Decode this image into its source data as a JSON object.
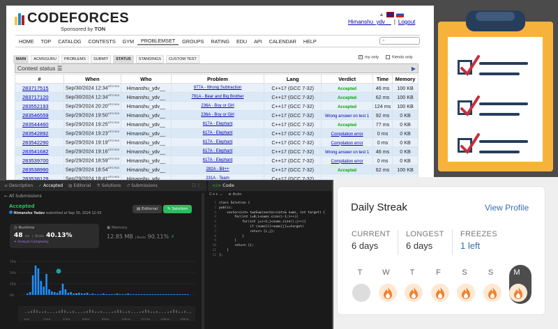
{
  "codeforces": {
    "brand": "CODEFORCES",
    "sponsor_prefix": "Sponsored by",
    "sponsor": "TON",
    "user": "Himanshu_ydv__",
    "logout": "Logout",
    "menu": [
      "HOME",
      "TOP",
      "CATALOG",
      "CONTESTS",
      "GYM",
      "PROBLEMSET",
      "GROUPS",
      "RATING",
      "EDU",
      "API",
      "CALENDAR",
      "HELP"
    ],
    "subtabs": [
      "MAIN",
      "ACMSGURU",
      "PROBLEMS",
      "SUBMIT",
      "STATUS",
      "STANDINGS",
      "CUSTOM TEST"
    ],
    "my_only": "my only",
    "friends_only": "friends only",
    "status_title": "Contest status",
    "columns": [
      "#",
      "When",
      "Who",
      "Problem",
      "Lang",
      "Verdict",
      "Time",
      "Memory"
    ],
    "rows": [
      {
        "id": "283717515",
        "when": "Sep/30/2024 12:34",
        "who": "Himanshu_ydv__",
        "problem": "977A - Wrong Subtraction",
        "lang": "C++17 (GCC 7-32)",
        "verdict": "Accepted",
        "vclass": "acc",
        "time": "46 ms",
        "mem": "100 KB"
      },
      {
        "id": "283717120",
        "when": "Sep/30/2024 12:34",
        "who": "Himanshu_ydv__",
        "problem": "791A - Bear and Big Brother",
        "lang": "C++17 (GCC 7-32)",
        "verdict": "Accepted",
        "vclass": "acc",
        "time": "62 ms",
        "mem": "100 KB"
      },
      {
        "id": "283552193",
        "when": "Sep/29/2024 20:20",
        "who": "Himanshu_ydv__",
        "problem": "236A - Boy or Girl",
        "lang": "C++17 (GCC 7-32)",
        "verdict": "Accepted",
        "vclass": "acc",
        "time": "124 ms",
        "mem": "100 KB"
      },
      {
        "id": "283546559",
        "when": "Sep/29/2024 19:50",
        "who": "Himanshu_ydv__",
        "problem": "236A - Boy or Girl",
        "lang": "C++17 (GCC 7-32)",
        "verdict": "Wrong answer on test 1",
        "vclass": "wa",
        "time": "92 ms",
        "mem": "0 KB"
      },
      {
        "id": "283544460",
        "when": "Sep/29/2024 19:25",
        "who": "Himanshu_ydv__",
        "problem": "617A - Elephant",
        "lang": "C++17 (GCC 7-32)",
        "verdict": "Accepted",
        "vclass": "acc",
        "time": "77 ms",
        "mem": "0 KB"
      },
      {
        "id": "283542892",
        "when": "Sep/29/2024 19:23",
        "who": "Himanshu_ydv__",
        "problem": "617A - Elephant",
        "lang": "C++17 (GCC 7-32)",
        "verdict": "Compilation error",
        "vclass": "ce",
        "time": "0 ms",
        "mem": "0 KB"
      },
      {
        "id": "283542290",
        "when": "Sep/29/2024 19:19",
        "who": "Himanshu_ydv__",
        "problem": "617A - Elephant",
        "lang": "C++17 (GCC 7-32)",
        "verdict": "Compilation error",
        "vclass": "ce",
        "time": "0 ms",
        "mem": "0 KB"
      },
      {
        "id": "283541682",
        "when": "Sep/29/2024 19:16",
        "who": "Himanshu_ydv__",
        "problem": "617A - Elephant",
        "lang": "C++17 (GCC 7-32)",
        "verdict": "Wrong answer on test 1",
        "vclass": "wa",
        "time": "46 ms",
        "mem": "0 KB"
      },
      {
        "id": "283539700",
        "when": "Sep/29/2024 18:59",
        "who": "Himanshu_ydv__",
        "problem": "617A - Elephant",
        "lang": "C++17 (GCC 7-32)",
        "verdict": "Compilation error",
        "vclass": "ce",
        "time": "0 ms",
        "mem": "0 KB"
      },
      {
        "id": "283538990",
        "when": "Sep/29/2024 18:54",
        "who": "Himanshu_ydv__",
        "problem": "282A - Bit++",
        "lang": "C++17 (GCC 7-32)",
        "verdict": "Accepted",
        "vclass": "acc",
        "time": "62 ms",
        "mem": "100 KB"
      },
      {
        "id": "283538129",
        "when": "Sep/29/2024 18:41",
        "who": "Himanshu_ydv__",
        "problem": "231A - Team",
        "lang": "C++17 (GCC 7-32)",
        "verdict": "Accepted",
        "vclass": "acc",
        "time": "78 ms",
        "mem": "0 KB"
      }
    ],
    "utc": "UTC+5.5"
  },
  "leetcode": {
    "tabs": [
      "Description",
      "Accepted",
      "Editorial",
      "Solutions",
      "Submissions"
    ],
    "code_tab": "Code",
    "lang": "C++",
    "auto": "Auto",
    "all_submissions": "All Submissions",
    "status": "Accepted",
    "submitted_by": "Himanshu Yadav",
    "submitted_at": "submitted at Sep 30, 2024 12:43",
    "editorial_btn": "Editorial",
    "solution_btn": "Solution",
    "runtime_label": "Runtime",
    "runtime_val": "48",
    "runtime_unit": "ms",
    "beats_label": "Beats",
    "runtime_beats": "40.13%",
    "complexity": "Analyze Complexity",
    "memory_label": "Memory",
    "memory_val": "12.85 MB",
    "memory_beats": "90.11%",
    "chart_x_labels": [
      "1ms",
      "22ms",
      "43ms",
      "64ms",
      "85ms",
      "106ms",
      "127ms",
      "148ms",
      "169ms"
    ],
    "chart_y_labels": [
      "75%",
      "50%",
      "25%",
      "0%"
    ],
    "code_lines": [
      "class Solution {",
      "public:",
      "    vector<int> twoSum(vector<int>& nums, int target) {",
      "        for(int i=0;i<nums.size()-1;i++){",
      "            for(int j=i+1;j<nums.size();j++){",
      "                if (nums[i]+nums[j]==target)",
      "                return {i,j};",
      "            }",
      "        }",
      "        return {};",
      "    }",
      "};"
    ]
  },
  "streak": {
    "title": "Daily Streak",
    "view_profile": "View Profile",
    "current_label": "CURRENT",
    "current_val": "6 days",
    "longest_label": "LONGEST",
    "longest_val": "6 days",
    "freezes_label": "FREEZES",
    "freezes_val": "1 left",
    "days": [
      "T",
      "W",
      "T",
      "F",
      "S",
      "S",
      "M"
    ]
  }
}
